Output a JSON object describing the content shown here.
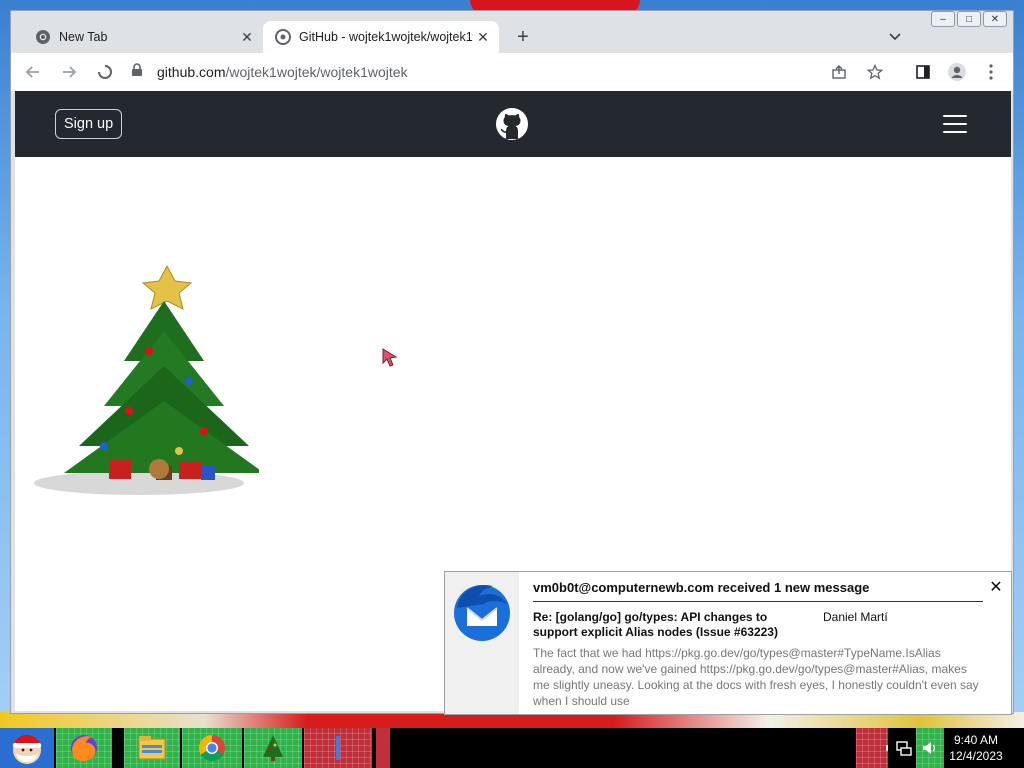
{
  "browser": {
    "tabs": [
      {
        "title": "New Tab",
        "active": false,
        "icon": "chrome-icon"
      },
      {
        "title": "GitHub - wojtek1wojtek/wojtek1wojtek",
        "active": true,
        "icon": "github-favicon"
      }
    ],
    "new_tab_symbol": "+",
    "url": {
      "host": "github.com",
      "path": "/wojtek1wojtek/wojtek1wojtek"
    },
    "window_controls": {
      "minimize": "–",
      "maximize": "□",
      "close": "✕"
    }
  },
  "github": {
    "signup_label": "Sign up",
    "header_color": "#24292f"
  },
  "notification": {
    "title": "vm0b0t@computernewb.com received 1 new message",
    "subject": "Re: [golang/go] go/types: API changes to support explicit Alias nodes (Issue #63223)",
    "sender": "Daniel Martí",
    "body": "The fact that we had https://pkg.go.dev/go/types@master#TypeName.IsAlias already, and now we've gained https://pkg.go.dev/go/types@master#Alias, makes me slightly uneasy. Looking at the docs with fresh eyes, I honestly couldn't even say when I should use",
    "close_symbol": "✕"
  },
  "taskbar": {
    "time": "9:40 AM",
    "date": "12/4/2023",
    "apps": [
      "santa-start-icon",
      "firefox-icon",
      "file-explorer-icon",
      "chrome-icon",
      "christmas-tree-icon"
    ]
  },
  "colors": {
    "tab_bar": "#dee1e6",
    "taskbar_green": "#2fb34a",
    "taskbar_red": "#c0303c"
  }
}
